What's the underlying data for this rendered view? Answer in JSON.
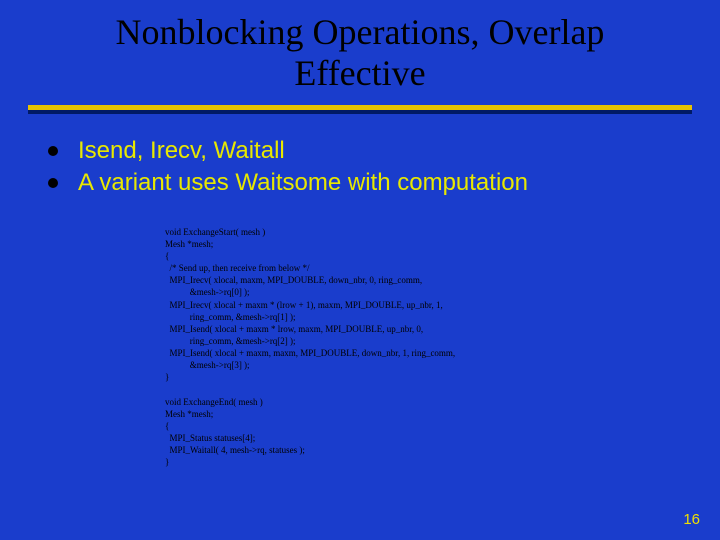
{
  "title": "Nonblocking Operations, Overlap Effective",
  "bullets": [
    "Isend, Irecv, Waitall",
    "A variant uses Waitsome with computation"
  ],
  "code": {
    "l0": "void ExchangeStart( mesh )",
    "l1": "Mesh *mesh;",
    "l2": "{",
    "l3": "  /* Send up, then receive from below */",
    "l4": "  MPI_Irecv( xlocal, maxm, MPI_DOUBLE, down_nbr, 0, ring_comm,",
    "l5": "           &mesh->rq[0] );",
    "l6": "  MPI_Irecv( xlocal + maxm * (lrow + 1), maxm, MPI_DOUBLE, up_nbr, 1,",
    "l7": "           ring_comm, &mesh->rq[1] );",
    "l8": "  MPI_Isend( xlocal + maxm * lrow, maxm, MPI_DOUBLE, up_nbr, 0,",
    "l9": "           ring_comm, &mesh->rq[2] );",
    "l10": "  MPI_Isend( xlocal + maxm, maxm, MPI_DOUBLE, down_nbr, 1, ring_comm,",
    "l11": "           &mesh->rq[3] );",
    "l12": "}",
    "l13": "",
    "l14": "void ExchangeEnd( mesh )",
    "l15": "Mesh *mesh;",
    "l16": "{",
    "l17": "  MPI_Status statuses[4];",
    "l18": "  MPI_Waitall( 4, mesh->rq, statuses );",
    "l19": "}"
  },
  "page_number": "16"
}
